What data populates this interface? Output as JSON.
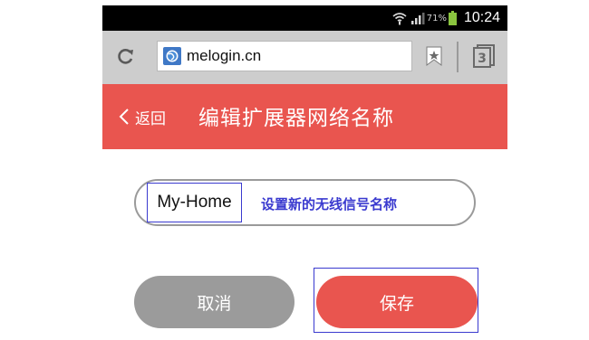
{
  "status_bar": {
    "battery_percent": "71%",
    "time": "10:24",
    "icons": [
      "wifi-icon",
      "signal-icon",
      "battery-icon"
    ]
  },
  "browser": {
    "url": "melogin.cn",
    "icons": [
      "refresh-icon",
      "globe-icon",
      "bookmark-icon",
      "tabs-icon"
    ],
    "tab_count": "3"
  },
  "header": {
    "back_label": "返回",
    "title": "编辑扩展器网络名称",
    "background_color": "#e9554f"
  },
  "form": {
    "ssid_value": "My-Home",
    "ssid_hint": "设置新的无线信号名称",
    "hint_color": "#3a3acf"
  },
  "actions": {
    "cancel_label": "取消",
    "save_label": "保存",
    "cancel_color": "#9b9b9b",
    "save_color": "#e9554f"
  }
}
